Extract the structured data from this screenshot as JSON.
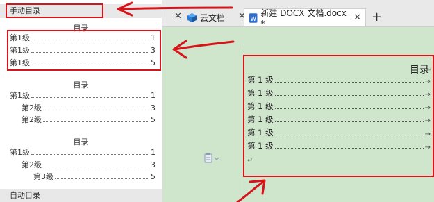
{
  "panel": {
    "manual_toc_header": "手动目录",
    "auto_toc_header": "自动目录",
    "style1": {
      "title": "目录",
      "rows": [
        {
          "label": "第1级",
          "page": "1"
        },
        {
          "label": "第1级",
          "page": "3"
        },
        {
          "label": "第1级",
          "page": "5"
        }
      ]
    },
    "style2": {
      "title": "目录",
      "rows": [
        {
          "label": "第1级",
          "page": "1"
        },
        {
          "label": "第2级",
          "page": "3"
        },
        {
          "label": "第2级",
          "page": "5"
        }
      ]
    },
    "style3": {
      "title": "目录",
      "rows": [
        {
          "label": "第1级",
          "page": "1"
        },
        {
          "label": "第2级",
          "page": "3"
        },
        {
          "label": "第3级",
          "page": "5"
        }
      ]
    }
  },
  "tabs": [
    {
      "label": "云文档"
    },
    {
      "label": "新建 DOCX 文档.docx *"
    }
  ],
  "document": {
    "toc_title": "目录",
    "rows": [
      "第 1 级",
      "第 1 级",
      "第 1 级",
      "第 1 级",
      "第 1 级",
      "第 1 级"
    ]
  },
  "colors": {
    "highlight_red": "#d7141a",
    "canvas_green": "#cfe5cc",
    "cloud_blue": "#2a7bd3",
    "docx_blue": "#2f6fd1"
  }
}
